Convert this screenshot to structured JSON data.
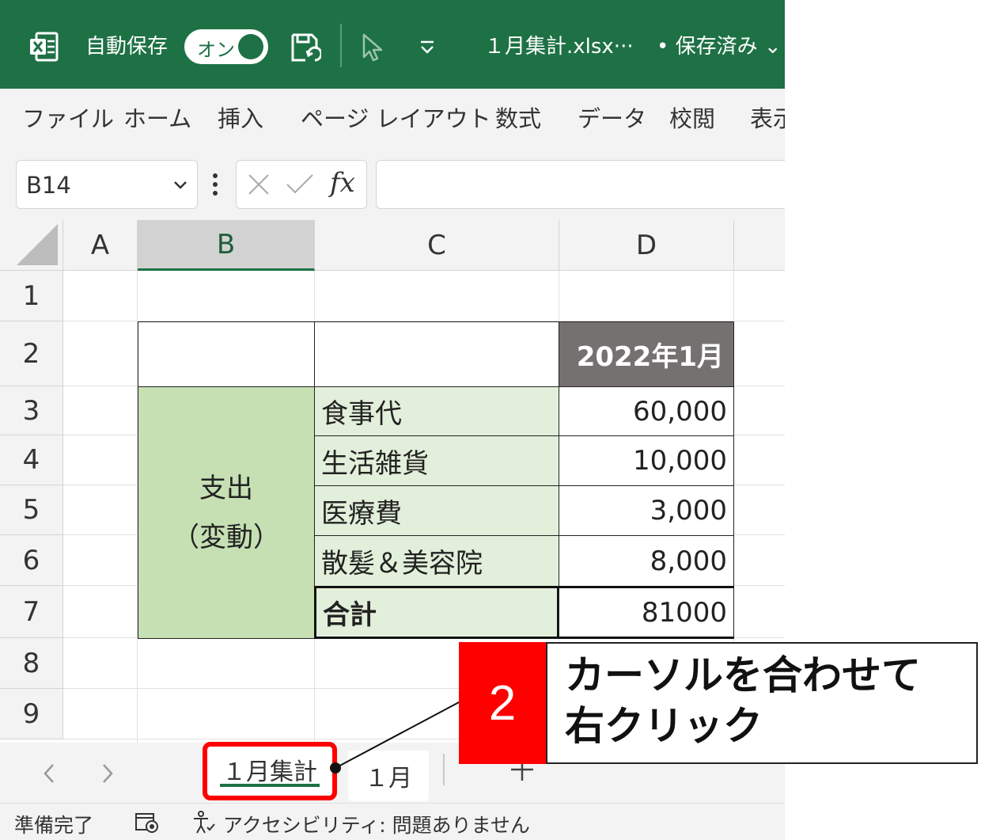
{
  "titlebar": {
    "autosave_label": "自動保存",
    "toggle_label": "オン",
    "filename": "１月集計.xlsx···",
    "save_state": "• 保存済み ⌄"
  },
  "ribbon": {
    "tabs": [
      "ファイル",
      "ホーム",
      "挿入",
      "ページ レイアウト",
      "数式",
      "データ",
      "校閲",
      "表示"
    ]
  },
  "formula_bar": {
    "name_box": "B14",
    "fx": "fx",
    "content": ""
  },
  "grid": {
    "columns": [
      "A",
      "B",
      "C",
      "D"
    ],
    "selected_column": "B",
    "rows": [
      "1",
      "2",
      "3",
      "4",
      "5",
      "6",
      "7",
      "8",
      "9"
    ],
    "header_cell": "2022年1月",
    "group_label_line1": "支出",
    "group_label_line2": "（変動）",
    "items": [
      {
        "name": "食事代",
        "value": "60,000"
      },
      {
        "name": "生活雑貨",
        "value": "10,000"
      },
      {
        "name": "医療費",
        "value": "3,000"
      },
      {
        "name": "散髪＆美容院",
        "value": "8,000"
      }
    ],
    "total_label": "合計",
    "total_value": "81000"
  },
  "sheet_tabs": {
    "tabs": [
      "１月集計",
      "１月"
    ],
    "active": 0,
    "add": "＋"
  },
  "statusbar": {
    "ready": "準備完了",
    "accessibility": "アクセシビリティ: 問題ありません"
  },
  "annotation": {
    "step": "2",
    "line1": "カーソルを合わせて",
    "line2": "右クリック"
  },
  "colors": {
    "excel_green": "#1e7145",
    "header_fill": "#767171",
    "item_fill": "#e2efda",
    "group_fill": "#c6e0b4",
    "annotation_red": "#ff0000"
  }
}
